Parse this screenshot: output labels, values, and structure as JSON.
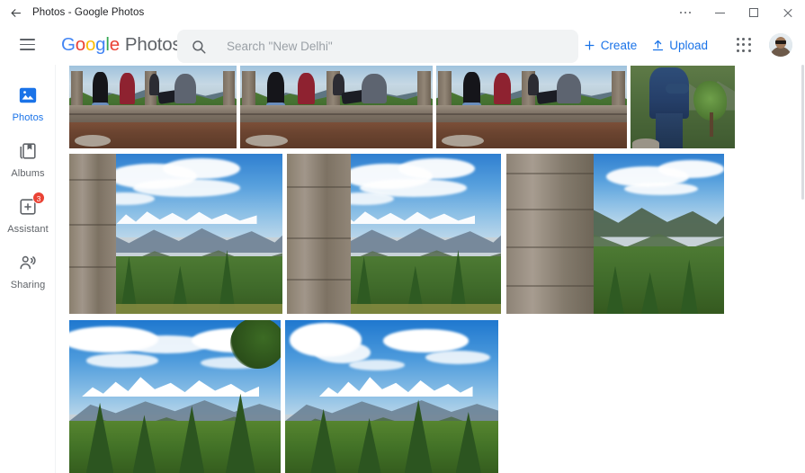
{
  "window": {
    "title": "Photos - Google Photos",
    "back_icon": "back-arrow-icon",
    "more_icon": "more-options-icon",
    "minimize_icon": "minimize-icon",
    "maximize_icon": "maximize-icon",
    "close_icon": "close-icon"
  },
  "header": {
    "menu_icon": "hamburger-menu-icon",
    "brand": {
      "g1": "G",
      "o1": "o",
      "o2": "o",
      "g2": "g",
      "l": "l",
      "e": "e",
      "product": "Photos"
    },
    "search": {
      "icon": "search-icon",
      "placeholder": "Search \"New Delhi\"",
      "value": ""
    },
    "create_label": "Create",
    "create_icon": "plus-icon",
    "upload_label": "Upload",
    "upload_icon": "upload-icon",
    "apps_icon": "apps-grid-icon",
    "avatar_icon": "account-avatar"
  },
  "sidebar": {
    "items": [
      {
        "label": "Photos",
        "icon": "photos-icon",
        "active": true,
        "badge": ""
      },
      {
        "label": "Albums",
        "icon": "albums-icon",
        "active": false,
        "badge": ""
      },
      {
        "label": "Assistant",
        "icon": "assistant-icon",
        "active": false,
        "badge": "3"
      },
      {
        "label": "Sharing",
        "icon": "sharing-icon",
        "active": false,
        "badge": ""
      }
    ]
  },
  "colors": {
    "accent_blue": "#1a73e8",
    "google_blue": "#4285f4",
    "google_red": "#ea4335",
    "google_yellow": "#fbbc05",
    "google_green": "#34a853",
    "text_grey": "#5f6368",
    "search_bg": "#f1f3f4",
    "badge_red": "#ea4335"
  },
  "photo_grid": {
    "rows": [
      {
        "row_index": 1,
        "photos": [
          {
            "alt": "Three friends sitting on a stone terrace wall overlooking hills",
            "scene": "terrace"
          },
          {
            "alt": "Three friends sitting on a stone terrace wall, second shot",
            "scene": "terrace"
          },
          {
            "alt": "Three friends sitting on a stone terrace wall, third shot",
            "scene": "terrace"
          },
          {
            "alt": "Person in blue jacket standing beside a tree on a hillside",
            "scene": "person"
          }
        ]
      },
      {
        "row_index": 2,
        "photos": [
          {
            "alt": "Mountain valley framed by a stone pillar with pine forest",
            "scene": "valley"
          },
          {
            "alt": "Mountain valley with clouds framed by a stone pillar",
            "scene": "valley"
          },
          {
            "alt": "Green mountain ridge seen past a close stone pillar",
            "scene": "valley"
          }
        ]
      },
      {
        "row_index": 3,
        "photos": [
          {
            "alt": "Snow-capped Himalayan peaks above a pine forest",
            "scene": "peaks"
          },
          {
            "alt": "Snow-capped Himalayan peaks with cumulus clouds over the forest",
            "scene": "peaks"
          }
        ]
      }
    ]
  }
}
